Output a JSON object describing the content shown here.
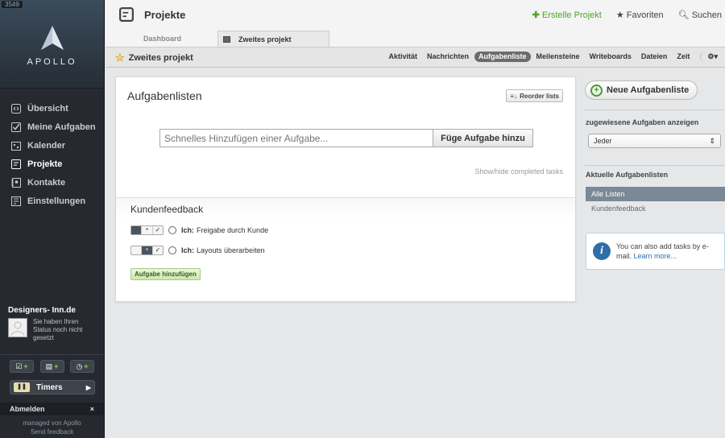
{
  "sidebar": {
    "build": "3549",
    "logo_text": "APOLLO",
    "nav": [
      {
        "label": "Übersicht",
        "icon": "overview-icon"
      },
      {
        "label": "Meine Aufgaben",
        "icon": "checkbox-icon"
      },
      {
        "label": "Kalender",
        "icon": "calendar-icon"
      },
      {
        "label": "Projekte",
        "icon": "projects-icon",
        "active": true
      },
      {
        "label": "Kontakte",
        "icon": "contacts-icon"
      },
      {
        "label": "Einstellungen",
        "icon": "settings-icon"
      }
    ],
    "org": "Designers- Inn.de",
    "status_text": "Sie haben Ihren Status noch nicht gesetzt",
    "timers_label": "Timers",
    "logout_label": "Abmelden",
    "close_glyph": "×",
    "managed_by": "managed von Apollo",
    "feedback": "Send feedback"
  },
  "topbar": {
    "title": "Projekte",
    "create_project": "Erstelle Projekt",
    "favorites": "Favoriten",
    "search": "Suchen"
  },
  "tabs": [
    {
      "label": "Dashboard"
    },
    {
      "label": "Zweites projekt",
      "active": true
    }
  ],
  "subbar": {
    "project_title": "Zweites projekt",
    "nav": [
      "Aktivität",
      "Nachrichten",
      "Aufgabenliste",
      "Meilensteine",
      "Writeboards",
      "Dateien",
      "Zeit"
    ],
    "active": "Aufgabenliste"
  },
  "main": {
    "heading": "Aufgabenlisten",
    "reorder_label": "Reorder lists",
    "quick_add_placeholder": "Schnelles Hinzufügen einer Aufgabe...",
    "quick_add_button": "Füge Aufgabe hinzu",
    "show_hide": "Show/hide completed tasks",
    "list_name": "Kundenfeedback",
    "tasks": [
      {
        "assignee": "Ich:",
        "text": "Freigabe durch Kunde"
      },
      {
        "assignee": "Ich:",
        "text": "Layouts überarbeiten"
      }
    ],
    "add_task_button": "Aufgabe hinzufügen"
  },
  "right": {
    "new_list_button": "Neue Aufgabenliste",
    "assigned_label": "zugewiesene Aufgaben anzeigen",
    "assigned_value": "Jeder",
    "current_lists_label": "Aktuelle Aufgabenlisten",
    "lists": [
      "Alle Listen",
      "Kundenfeedback"
    ],
    "info_text": "You can also add tasks by e-mail.",
    "info_link": "Learn more..."
  }
}
